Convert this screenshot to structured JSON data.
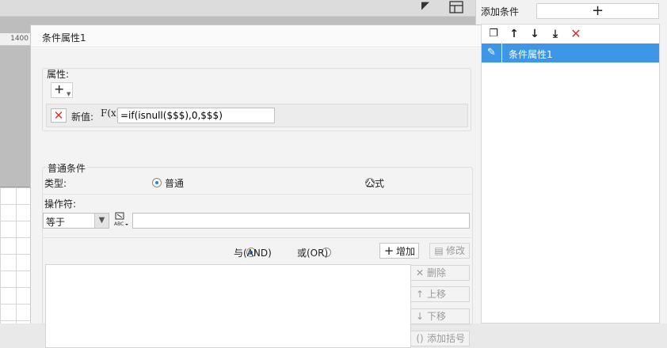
{
  "ruler": {
    "mark": "1400"
  },
  "dialog": {
    "title": "条件属性1",
    "property": {
      "label": "属性:",
      "add_symbol": "+",
      "new_value_label": "新值:",
      "formula_icon": "F(x)",
      "value": "=if(isnull($$$),0,$$$)"
    },
    "condition": {
      "title": "普通条件",
      "type_label": "类型:",
      "type_normal": "普通",
      "type_formula": "公式",
      "type_selected": "普通",
      "operator_label": "操作符:",
      "operator_value": "等于",
      "operand_value": "",
      "logic_and": "与(AND)",
      "logic_or": "或(OR)",
      "logic_selected": "与(AND)",
      "buttons": {
        "add": "增加",
        "modify": "修改",
        "delete": "删除",
        "move_up": "上移",
        "move_down": "下移",
        "add_bracket": "添加括号"
      }
    }
  },
  "right_panel": {
    "add_condition_label": "添加条件",
    "add_symbol": "+",
    "items": [
      {
        "label": "条件属性1",
        "selected": true
      }
    ]
  },
  "colors": {
    "selection": "#3d96e6",
    "delete_red": "#e03030"
  }
}
